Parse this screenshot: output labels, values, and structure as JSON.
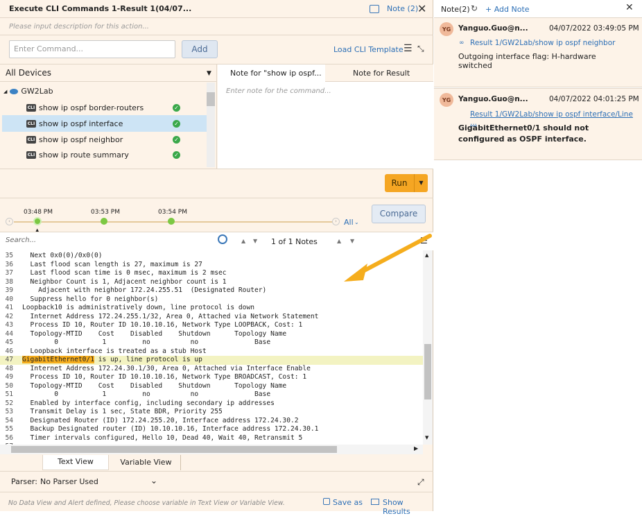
{
  "window": {
    "title": "Execute CLI Commands 1-Result 1(04/07...",
    "note_link": "Note (2)"
  },
  "description_placeholder": "Please input description for this action...",
  "command": {
    "placeholder": "Enter Command...",
    "add_label": "Add",
    "load_template": "Load CLI Template"
  },
  "devices": {
    "selector": "All Devices",
    "root": "GW2Lab",
    "commands": [
      {
        "label": "show ip ospf border-routers"
      },
      {
        "label": "show ip ospf interface"
      },
      {
        "label": "show ip ospf neighbor"
      },
      {
        "label": "show ip route summary"
      }
    ],
    "badge": "CLI"
  },
  "note_tabs": {
    "command_tab": "Note for \"show ip ospf...",
    "result_tab": "Note for Result",
    "placeholder": "Enter note for the command..."
  },
  "run_label": "Run",
  "timeline": {
    "times": [
      "03:48 PM",
      "03:53 PM",
      "03:54 PM"
    ],
    "all_label": "All",
    "compare_label": "Compare"
  },
  "search": {
    "placeholder": "Search...",
    "notes_counter": "1 of 1 Notes"
  },
  "output_lines": [
    {
      "n": "35",
      "t": "  Next 0x0(0)/0x0(0)"
    },
    {
      "n": "36",
      "t": "  Last flood scan length is 27, maximum is 27"
    },
    {
      "n": "37",
      "t": "  Last flood scan time is 0 msec, maximum is 2 msec"
    },
    {
      "n": "38",
      "t": "  Neighbor Count is 1, Adjacent neighbor count is 1"
    },
    {
      "n": "39",
      "t": "    Adjacent with neighbor 172.24.255.51  (Designated Router)"
    },
    {
      "n": "40",
      "t": "  Suppress hello for 0 neighbor(s)"
    },
    {
      "n": "41",
      "t": "Loopback10 is administratively down, line protocol is down"
    },
    {
      "n": "42",
      "t": "  Internet Address 172.24.255.1/32, Area 0, Attached via Network Statement"
    },
    {
      "n": "43",
      "t": "  Process ID 10, Router ID 10.10.10.16, Network Type LOOPBACK, Cost: 1"
    },
    {
      "n": "44",
      "t": "  Topology-MTID    Cost    Disabled    Shutdown      Topology Name"
    },
    {
      "n": "45",
      "t": "        0           1         no          no              Base"
    },
    {
      "n": "46",
      "t": "  Loopback interface is treated as a stub Host"
    },
    {
      "n": "47",
      "t": "GigabitEthernet0/1 is up, line protocol is up",
      "hl": "GigabitEthernet0/1"
    },
    {
      "n": "48",
      "t": "  Internet Address 172.24.30.1/30, Area 0, Attached via Interface Enable"
    },
    {
      "n": "49",
      "t": "  Process ID 10, Router ID 10.10.10.16, Network Type BROADCAST, Cost: 1"
    },
    {
      "n": "50",
      "t": "  Topology-MTID    Cost    Disabled    Shutdown      Topology Name"
    },
    {
      "n": "51",
      "t": "        0           1         no          no              Base"
    },
    {
      "n": "52",
      "t": "  Enabled by interface config, including secondary ip addresses"
    },
    {
      "n": "53",
      "t": "  Transmit Delay is 1 sec, State BDR, Priority 255"
    },
    {
      "n": "54",
      "t": "  Designated Router (ID) 172.24.255.20, Interface address 172.24.30.2"
    },
    {
      "n": "55",
      "t": "  Backup Designated router (ID) 10.10.10.16, Interface address 172.24.30.1"
    },
    {
      "n": "56",
      "t": "  Timer intervals configured, Hello 10, Dead 40, Wait 40, Retransmit 5"
    },
    {
      "n": "57",
      "t": ""
    }
  ],
  "view_tabs": {
    "text": "Text View",
    "variable": "Variable View"
  },
  "parser": {
    "label": "Parser:",
    "value": "No Parser Used"
  },
  "footer": {
    "message": "No Data View and Alert defined, Please choose variable in Text View or Variable View.",
    "save_as": "Save as",
    "show_results": "Show Results"
  },
  "notes_panel": {
    "title": "Note(2)",
    "add_note": "+ Add Note",
    "notes": [
      {
        "initials": "YG",
        "author": "Yanguo.Guo@n...",
        "time": "04/07/2022 03:49:05 PM",
        "ref": "Result 1/GW2Lab/show ip ospf neighbor",
        "text": "Outgoing interface flag: H-hardware switched"
      },
      {
        "initials": "YG",
        "author": "Yanguo.Guo@n...",
        "time": "04/07/2022 04:01:25 PM",
        "ref": "Result 1/GW2Lab/show ip ospf interface/Line ...",
        "text": "GigabitEthernet0/1 should not configured as OSPF interface."
      }
    ]
  },
  "colors": {
    "accent": "#f5a623",
    "link": "#2c6fb6",
    "selected_row": "#cde4f5",
    "highlight_line": "#f3f3c2",
    "timeline_dot": "#7cc843"
  }
}
